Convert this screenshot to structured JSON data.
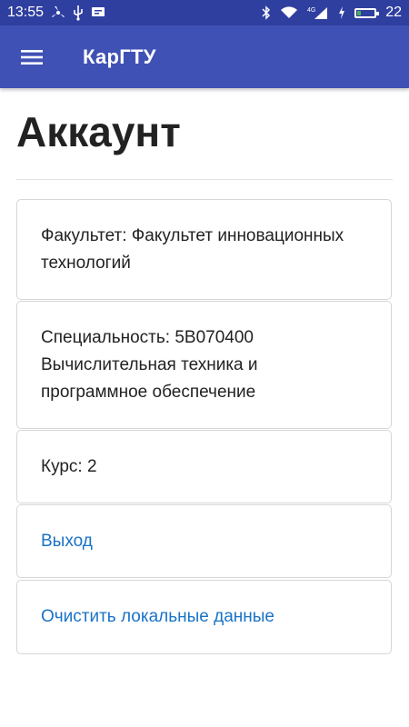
{
  "status_bar": {
    "time": "13:55",
    "battery_level": "22",
    "network": "4G",
    "battery_percent": 0.22
  },
  "app_bar": {
    "title": "КарГТУ",
    "menu_icon": "hamburger-menu-icon"
  },
  "page": {
    "title": "Аккаунт"
  },
  "cards": [
    {
      "text": "Факультет: Факультет инновационных технологий"
    },
    {
      "text": "Специальность: 5В070400 Вычислительная техника и программное обеспечение"
    },
    {
      "text": "Курс: 2"
    },
    {
      "text": "Выход"
    },
    {
      "text": "Очистить локальные данные"
    }
  ],
  "colors": {
    "status_bar": "#2f3fa0",
    "app_bar": "#3f51b5",
    "link": "#1a73c7",
    "text": "#222222",
    "card_border": "#d6d6d6"
  }
}
